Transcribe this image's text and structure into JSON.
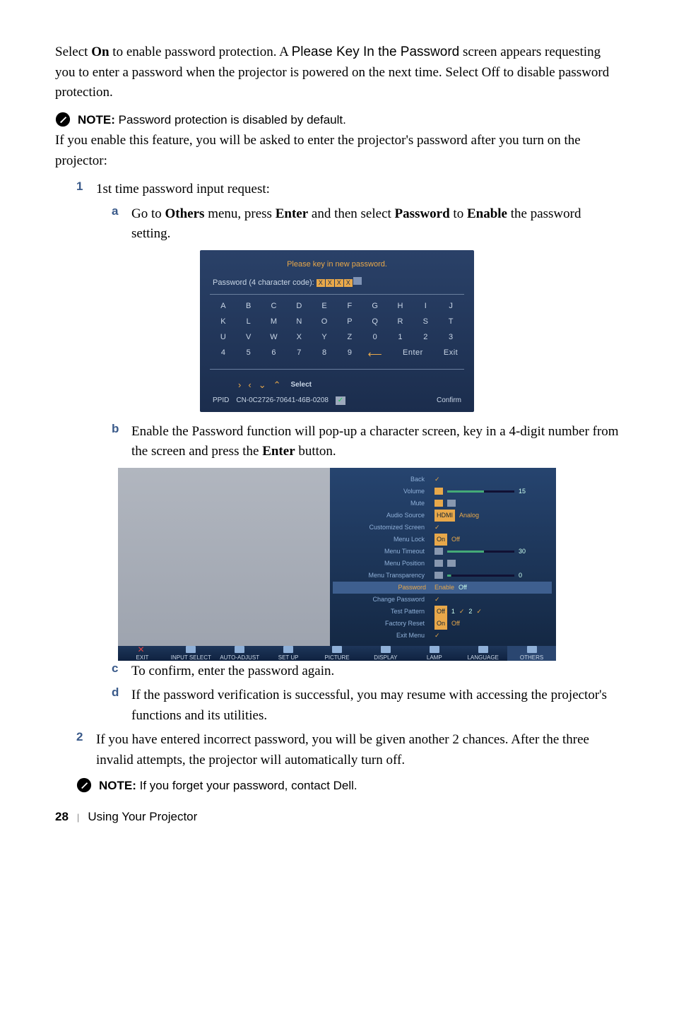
{
  "intro": {
    "p1_a": "Select ",
    "p1_b": "On",
    "p1_c": " to enable password protection. A ",
    "p1_d": "Please Key In the Password",
    "p1_e": " screen appears requesting you to enter a password when the projector is powered on the next time. Select Off  to disable password protection."
  },
  "note1": {
    "label": "NOTE:",
    "text": " Password protection is disabled by default."
  },
  "p2": "If you enable this feature, you will be asked to enter the projector's password after you turn on the projector:",
  "step1": {
    "num": "1",
    "text": "1st time password input request:",
    "a": {
      "letter": "a",
      "t1": "Go to ",
      "t2": "Others",
      "t3": " menu, press ",
      "t4": "Enter",
      "t5": " and then select ",
      "t6": "Password",
      "t7": " to ",
      "t8": "Enable",
      "t9": " the password setting."
    },
    "b": {
      "letter": "b",
      "t1": "Enable the Password function will pop-up a character screen, key in a 4-digit number from the screen and press the ",
      "t2": "Enter",
      "t3": " button."
    },
    "c": {
      "letter": "c",
      "text": "To confirm, enter the password again."
    },
    "d": {
      "letter": "d",
      "text": "If the password verification is successful, you may resume with accessing the projector's functions and its utilities."
    }
  },
  "step2": {
    "num": "2",
    "text": "If you have entered incorrect password, you will be given another 2 chances. After the three invalid attempts, the projector will automatically turn off."
  },
  "note2": {
    "label": "NOTE:",
    "text": " If you forget your password, contact Dell."
  },
  "footer": {
    "page": "28",
    "section": "Using Your Projector"
  },
  "osd1": {
    "title": "Please key in new password.",
    "prompt": "Password (4 character code):",
    "grid": [
      "A",
      "B",
      "C",
      "D",
      "E",
      "F",
      "G",
      "H",
      "I",
      "J",
      "K",
      "L",
      "M",
      "N",
      "O",
      "P",
      "Q",
      "R",
      "S",
      "T",
      "U",
      "V",
      "W",
      "X",
      "Y",
      "Z",
      "0",
      "1",
      "2",
      "3",
      "4",
      "5",
      "6",
      "7",
      "8",
      "9",
      "←",
      "Enter",
      "Exit"
    ],
    "select": "Select",
    "ppid_label": "PPID",
    "ppid": "CN-0C2726-70641-46B-0208",
    "confirm": "Confirm"
  },
  "osd2": {
    "labels": [
      "Back",
      "Volume",
      "Mute",
      "Audio Source",
      "Customized Screen",
      "Menu Lock",
      "Menu Timeout",
      "Menu Position",
      "Menu Transparency",
      "Password",
      "Change Password",
      "Test Pattern",
      "Factory Reset",
      "Exit Menu"
    ],
    "vol": "15",
    "audio": {
      "hdmi": "HDMI",
      "analog": "Analog"
    },
    "menulock": {
      "on": "On",
      "off": "Off"
    },
    "timeout": "30",
    "transp": "0",
    "password": {
      "enable": "Enable",
      "off": "Off"
    },
    "test": {
      "off": "Off",
      "one": "1",
      "two": "2"
    },
    "factory": {
      "on": "On",
      "off": "Off"
    },
    "tabs": [
      "EXIT",
      "INPUT SELECT",
      "AUTO-ADJUST",
      "SET UP",
      "PICTURE",
      "DISPLAY",
      "LAMP",
      "LANGUAGE",
      "OTHERS"
    ]
  }
}
